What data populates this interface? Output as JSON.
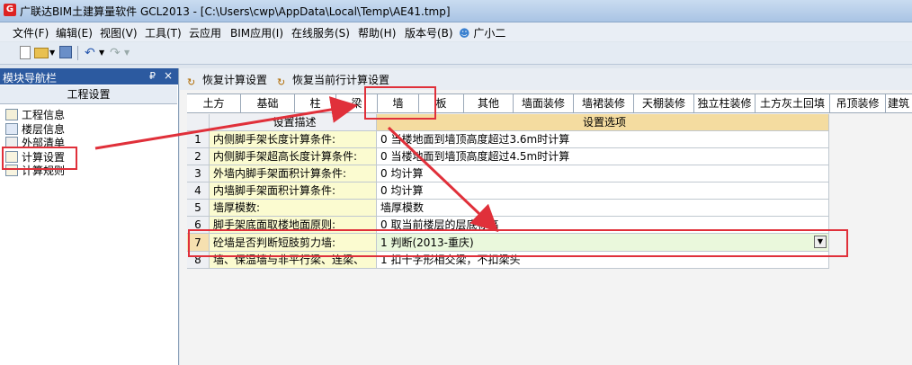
{
  "window": {
    "title": "广联达BIM土建算量软件 GCL2013 - [C:\\Users\\cwp\\AppData\\Local\\Temp\\AE41.tmp]"
  },
  "menubar": {
    "items": [
      "文件(F)",
      "编辑(E)",
      "视图(V)",
      "工具(T)",
      "云应用",
      "BIM应用(I)",
      "在线服务(S)",
      "帮助(H)",
      "版本号(B)",
      "广小二"
    ]
  },
  "left_panel": {
    "title": "模块导航栏",
    "pin": "₽",
    "close": "×",
    "group": "工程设置",
    "items": [
      "工程信息",
      "楼层信息",
      "外部清单",
      "计算设置",
      "计算规则"
    ]
  },
  "restore_bar": {
    "restore_calc": "恢复计算设置",
    "restore_row": "恢复当前行计算设置"
  },
  "tabs": [
    "土方",
    "基础",
    "柱",
    "梁",
    "墙",
    "板",
    "其他",
    "墙面装修",
    "墙裙装修",
    "天棚装修",
    "独立柱装修",
    "土方灰土回填",
    "吊顶装修",
    "建筑"
  ],
  "active_tab": "墙",
  "grid": {
    "headers": {
      "desc": "设置描述",
      "value": "设置选项"
    },
    "rows": [
      {
        "num": "1",
        "desc": "内侧脚手架长度计算条件:",
        "value": "0 当楼地面到墙顶高度超过3.6m时计算"
      },
      {
        "num": "2",
        "desc": "内侧脚手架超高长度计算条件:",
        "value": "0 当楼地面到墙顶高度超过4.5m时计算"
      },
      {
        "num": "3",
        "desc": "外墙内脚手架面积计算条件:",
        "value": "0 均计算"
      },
      {
        "num": "4",
        "desc": "内墙脚手架面积计算条件:",
        "value": "0 均计算"
      },
      {
        "num": "5",
        "desc": "墙厚模数:",
        "value": "墙厚模数"
      },
      {
        "num": "6",
        "desc": "脚手架底面取楼地面原则:",
        "value": "0 取当前楼层的层底标高"
      },
      {
        "num": "7",
        "desc": "砼墙是否判断短肢剪力墙:",
        "value": "1 判断(2013-重庆)"
      },
      {
        "num": "8",
        "desc": "墙、保温墙与非平行梁、连梁、",
        "value": "1 扣十字形相交梁，不扣梁头"
      }
    ],
    "selected_row": "7"
  },
  "colors": {
    "annotation": "#e0303a",
    "header_value_bg": "#f4dca0",
    "desc_bg": "#fbfbd0",
    "selected_bg": "#eaf8dc"
  }
}
